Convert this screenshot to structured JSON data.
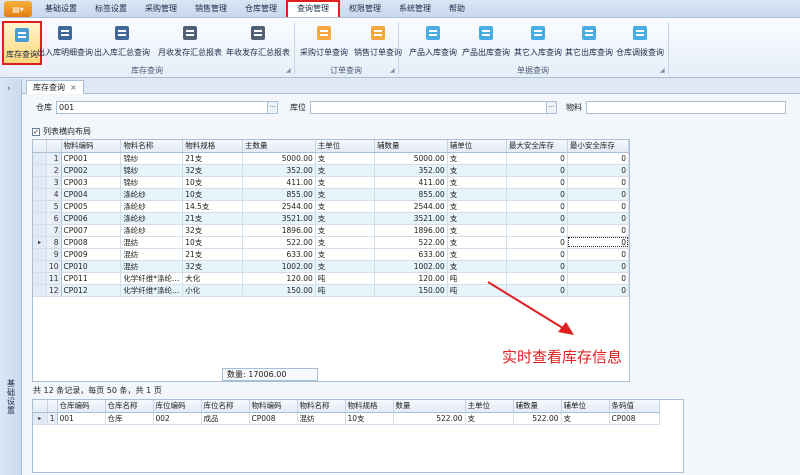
{
  "menu": {
    "app_icon": "app-menu-icon",
    "items": [
      "基础设置",
      "标签设置",
      "采购管理",
      "销售管理",
      "仓库管理",
      "查询管理",
      "权限管理",
      "系统管理",
      "帮助"
    ],
    "active_index": 5
  },
  "ribbon": {
    "buttons": [
      {
        "label": "库存查询",
        "icon": "stock-query-icon"
      },
      {
        "label": "出入库明细查询",
        "icon": "inout-detail-icon"
      },
      {
        "label": "出入库汇总查询",
        "icon": "inout-summary-icon"
      },
      {
        "label": "月收发存汇总报表",
        "icon": "monthly-report-icon"
      },
      {
        "label": "年收发存汇总报表",
        "icon": "yearly-report-icon"
      },
      {
        "label": "采购订单查询",
        "icon": "purchase-order-icon"
      },
      {
        "label": "销售订单查询",
        "icon": "sales-order-icon"
      },
      {
        "label": "产品入库查询",
        "icon": "product-in-icon"
      },
      {
        "label": "产品出库查询",
        "icon": "product-out-icon"
      },
      {
        "label": "其它入库查询",
        "icon": "other-in-icon"
      },
      {
        "label": "其它出库查询",
        "icon": "other-out-icon"
      },
      {
        "label": "仓库调拨查询",
        "icon": "transfer-icon"
      }
    ],
    "groups": [
      "库存查询",
      "订单查询",
      "单据查询"
    ]
  },
  "left_panel": {
    "label": "基础设置"
  },
  "tab": {
    "label": "库存查询",
    "close": "×"
  },
  "filters": {
    "warehouse_label": "仓库",
    "warehouse_value": "001",
    "location_label": "库位",
    "location_value": "",
    "material_label": "物料",
    "material_value": "",
    "ellipsis": "···"
  },
  "horizontal_layout": {
    "label": "列表横向布局",
    "checked": true
  },
  "stock_grid": {
    "columns": [
      "物料编码",
      "物料名称",
      "物料规格",
      "主数量",
      "主单位",
      "辅数量",
      "辅单位",
      "最大安全库存",
      "最小安全库存"
    ],
    "rows": [
      [
        "1",
        "CP001",
        "锦纱",
        "21支",
        "5000.00",
        "支",
        "5000.00",
        "支",
        "0",
        "0"
      ],
      [
        "2",
        "CP002",
        "锦纱",
        "32支",
        "352.00",
        "支",
        "352.00",
        "支",
        "0",
        "0"
      ],
      [
        "3",
        "CP003",
        "锦纱",
        "10支",
        "411.00",
        "支",
        "411.00",
        "支",
        "0",
        "0"
      ],
      [
        "4",
        "CP004",
        "涤纶纱",
        "10支",
        "855.00",
        "支",
        "855.00",
        "支",
        "0",
        "0"
      ],
      [
        "5",
        "CP005",
        "涤纶纱",
        "14.5支",
        "2544.00",
        "支",
        "2544.00",
        "支",
        "0",
        "0"
      ],
      [
        "6",
        "CP006",
        "涤纶纱",
        "21支",
        "3521.00",
        "支",
        "3521.00",
        "支",
        "0",
        "0"
      ],
      [
        "7",
        "CP007",
        "涤纶纱",
        "32支",
        "1896.00",
        "支",
        "1896.00",
        "支",
        "0",
        "0"
      ],
      [
        "8",
        "CP008",
        "混纺",
        "10支",
        "522.00",
        "支",
        "522.00",
        "支",
        "0",
        "0"
      ],
      [
        "9",
        "CP009",
        "混纺",
        "21支",
        "633.00",
        "支",
        "633.00",
        "支",
        "0",
        "0"
      ],
      [
        "10",
        "CP010",
        "混纺",
        "32支",
        "1002.00",
        "支",
        "1002.00",
        "支",
        "0",
        "0"
      ],
      [
        "11",
        "CP011",
        "化学纤维*涤纶...",
        "大化",
        "120.00",
        "吨",
        "120.00",
        "吨",
        "0",
        "0"
      ],
      [
        "12",
        "CP012",
        "化学纤维*涤纶...",
        "小化",
        "150.00",
        "吨",
        "150.00",
        "吨",
        "0",
        "0"
      ]
    ],
    "selected_row": 8,
    "sum_label": "数量: 17006.00"
  },
  "paging": {
    "text": "共 12 条记录，每页 50 条，共 1 页"
  },
  "detail_grid": {
    "columns": [
      "仓库编码",
      "仓库名称",
      "库位编码",
      "库位名称",
      "物料编码",
      "物料名称",
      "物料规格",
      "数量",
      "主单位",
      "辅数量",
      "辅单位",
      "条码值"
    ],
    "rows": [
      [
        "1",
        "001",
        "仓库",
        "002",
        "成品",
        "CP008",
        "混纺",
        "10支",
        "522.00",
        "支",
        "522.00",
        "支",
        "CP008"
      ]
    ]
  },
  "annotation": {
    "text": "实时查看库存信息",
    "color": "#e02020"
  }
}
